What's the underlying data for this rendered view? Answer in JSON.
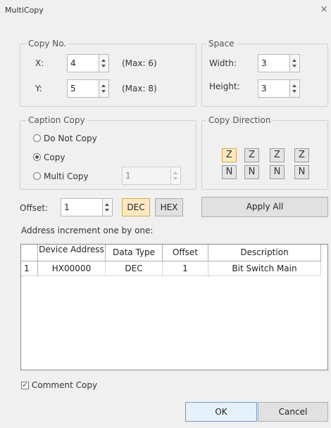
{
  "window": {
    "title": "MultiCopy",
    "close_glyph": "×"
  },
  "copy_no": {
    "title": "Copy No.",
    "x": {
      "label": "X:",
      "value": "4",
      "max": "(Max: 6)"
    },
    "y": {
      "label": "Y:",
      "value": "5",
      "max": "(Max: 8)"
    }
  },
  "space": {
    "title": "Space",
    "width": {
      "label": "Width:",
      "value": "3"
    },
    "height": {
      "label": "Height:",
      "value": "3"
    }
  },
  "caption_copy": {
    "title": "Caption Copy",
    "options": [
      "Do Not Copy",
      "Copy",
      "Multi Copy"
    ],
    "selected": "Copy",
    "multi_value": "1"
  },
  "copy_direction": {
    "title": "Copy Direction",
    "buttons": [
      "Z",
      "Z",
      "Z",
      "Z",
      "N",
      "N",
      "N",
      "N"
    ],
    "active_index": 0
  },
  "offset": {
    "label": "Offset:",
    "value": "1",
    "dec_label": "DEC",
    "hex_label": "HEX",
    "active": "DEC",
    "apply_all_label": "Apply All"
  },
  "address_note": "Address increment one by one:",
  "table": {
    "headers": [
      "Device Address",
      "Data Type",
      "Offset",
      "Description"
    ],
    "rows": [
      {
        "index": "1",
        "device": "HX00000",
        "type": "DEC",
        "offset": "1",
        "desc": "Bit Switch Main"
      }
    ]
  },
  "comment_copy": {
    "label": "Comment Copy",
    "checked": true,
    "check_glyph": "✓"
  },
  "footer": {
    "ok_label": "OK",
    "cancel_label": "Cancel"
  },
  "colors": {
    "active_bg": "#fde9c2",
    "primary_border": "#6f9bd1",
    "dialog_bg": "#f0f0f0"
  }
}
